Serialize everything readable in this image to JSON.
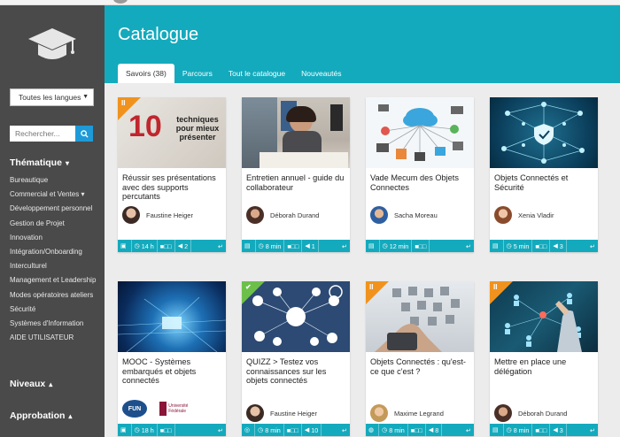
{
  "sidebar": {
    "language_select": "Toutes les langues",
    "search_placeholder": "Rechercher...",
    "sections": {
      "thematique": "Thématique",
      "niveaux": "Niveaux",
      "approbation": "Approbation"
    },
    "links": [
      "Bureautique",
      "Commercial et Ventes",
      "Développement personnel",
      "Gestion de Projet",
      "Innovation",
      "Intégration/Onboarding",
      "Interculturel",
      "Management et Leadership",
      "Modes opératoires ateliers",
      "Sécurité",
      "Systèmes d'Information",
      "AIDE UTILISATEUR"
    ]
  },
  "header": {
    "title": "Catalogue",
    "tabs": [
      "Savoirs (38)",
      "Parcours",
      "Tout le catalogue",
      "Nouveautés"
    ]
  },
  "colors": {
    "accent": "#14aabd",
    "sidebar": "#4a4a4a",
    "ribbon_orange": "#f0931e",
    "ribbon_green": "#6cc04a",
    "button_blue": "#1f9ad8"
  },
  "cards": [
    {
      "title": "Réussir ses présentations avec des supports percutants",
      "author": "Faustine Heiger",
      "duration": "14 h",
      "level": "■□□",
      "count": "2",
      "thumb_text_big": "10",
      "thumb_text_small": "techniques pour mieux présenter"
    },
    {
      "title": "Entretien annuel - guide du collaborateur",
      "author": "Déborah Durand",
      "duration": "8 min",
      "level": "■□□",
      "count": "1"
    },
    {
      "title": "Vade Mecum des Objets Connectes",
      "author": "Sacha Moreau",
      "duration": "12 min",
      "level": "■□□"
    },
    {
      "title": "Objets Connectés et Sécurité",
      "author": "Xenia Vladir",
      "duration": "5 min",
      "level": "■□□",
      "count": "3"
    },
    {
      "title": "MOOC - Systèmes embarqués et objets connectés",
      "duration": "18 h",
      "level": "■□□",
      "logo_fun": "FUN",
      "logo_univ": "Université Fédérale"
    },
    {
      "title": "QUIZZ > Testez vos connaissances sur les objets connectés",
      "author": "Faustine Heiger",
      "duration": "8 min",
      "level": "■□□",
      "count": "10"
    },
    {
      "title": "Objets Connectés : qu'est-ce que c'est ?",
      "author": "Maxime Legrand",
      "duration": "8 min",
      "level": "■□□",
      "count": "8"
    },
    {
      "title": "Mettre en place une délégation",
      "author": "Déborah Durand",
      "duration": "8 min",
      "level": "■□□",
      "count": "3"
    }
  ]
}
